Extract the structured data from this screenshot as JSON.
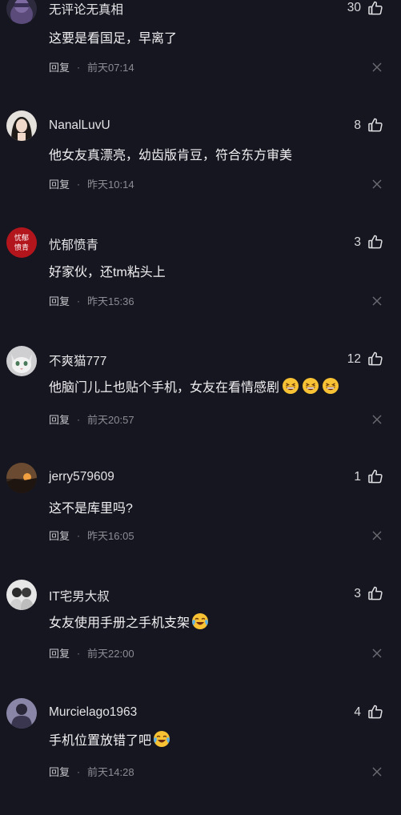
{
  "comments": [
    {
      "username": "无评论无真相",
      "likes": "30",
      "text": "这要是看国足，早离了",
      "reply_label": "回复",
      "separator": "·",
      "time": "前天07:14"
    },
    {
      "username": "NanalLuvU",
      "likes": "8",
      "text": "他女友真漂亮，幼齿版肯豆，符合东方审美",
      "reply_label": "回复",
      "separator": "·",
      "time": "昨天10:14"
    },
    {
      "username": "忧郁愤青",
      "likes": "3",
      "text": "好家伙，还tm粘头上",
      "reply_label": "回复",
      "separator": "·",
      "time": "昨天15:36",
      "avatar_text": "忧郁愤青"
    },
    {
      "username": "不爽猫777",
      "likes": "12",
      "text": "他脑门儿上也贴个手机，女友在看情感剧",
      "reply_label": "回复",
      "separator": "·",
      "time": "前天20:57"
    },
    {
      "username": "jerry579609",
      "likes": "1",
      "text": "这不是库里吗?",
      "reply_label": "回复",
      "separator": "·",
      "time": "昨天16:05"
    },
    {
      "username": "IT宅男大叔",
      "likes": "3",
      "text": "女友使用手册之手机支架",
      "reply_label": "回复",
      "separator": "·",
      "time": "前天22:00"
    },
    {
      "username": "Murcielago1963",
      "likes": "4",
      "text": "手机位置放错了吧",
      "reply_label": "回复",
      "separator": "·",
      "time": "前天14:28"
    }
  ],
  "icons": {
    "like": "thumbs-up-icon",
    "close": "close-icon",
    "laugh": "grinning-squint-emoji",
    "cry_laugh": "face-with-tears-of-joy-emoji"
  },
  "colors": {
    "background": "#161620",
    "text": "#f0f0f2",
    "meta": "#8c8c94"
  }
}
